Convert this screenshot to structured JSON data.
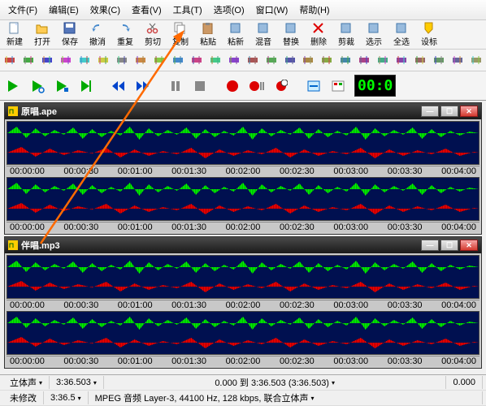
{
  "menu": [
    "文件(F)",
    "编辑(E)",
    "效果(C)",
    "查看(V)",
    "工具(T)",
    "选项(O)",
    "窗口(W)",
    "帮助(H)"
  ],
  "toolbar1": [
    {
      "name": "new",
      "label": "新建"
    },
    {
      "name": "open",
      "label": "打开"
    },
    {
      "name": "save",
      "label": "保存"
    },
    {
      "name": "undo",
      "label": "撤消"
    },
    {
      "name": "redo",
      "label": "重复"
    },
    {
      "name": "cut",
      "label": "剪切"
    },
    {
      "name": "copy",
      "label": "复制"
    },
    {
      "name": "paste",
      "label": "粘贴"
    },
    {
      "name": "paste-new",
      "label": "粘新"
    },
    {
      "name": "mix",
      "label": "混音"
    },
    {
      "name": "replace",
      "label": "替换"
    },
    {
      "name": "delete",
      "label": "删除"
    },
    {
      "name": "trim",
      "label": "剪裁"
    },
    {
      "name": "select",
      "label": "选示"
    },
    {
      "name": "select-all",
      "label": "全选"
    },
    {
      "name": "marker",
      "label": "设标"
    }
  ],
  "timer": "00:0",
  "track1": {
    "title": "原唱.ape"
  },
  "track2": {
    "title": "伴唱.mp3"
  },
  "ruler": [
    "00:00:00",
    "00:00:30",
    "00:01:00",
    "00:01:30",
    "00:02:00",
    "00:02:30",
    "00:03:00",
    "00:03:30",
    "00:04:00"
  ],
  "status": {
    "channel": "立体声",
    "time1": "3:36.503",
    "range": "0.000 到 3:36.503 (3:36.503)",
    "zero": "0.000",
    "modified": "未修改",
    "time2": "3:36.5",
    "format": "MPEG 音频 Layer-3, 44100 Hz, 128 kbps, 联合立体声"
  }
}
